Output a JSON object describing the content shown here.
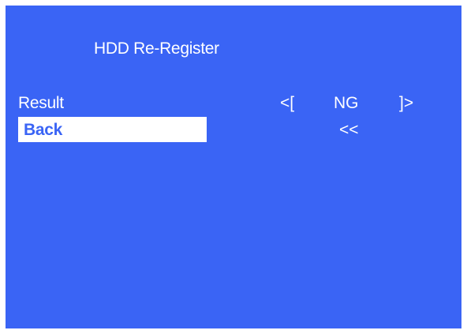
{
  "screen": {
    "title": "HDD Re-Register",
    "bg_color": "#3a64f5"
  },
  "menu": {
    "result": {
      "label": "Result",
      "bracket_open": "<[",
      "value": "NG",
      "bracket_close": "]>"
    },
    "back": {
      "label": "Back",
      "value": "<<",
      "selected": true
    }
  }
}
